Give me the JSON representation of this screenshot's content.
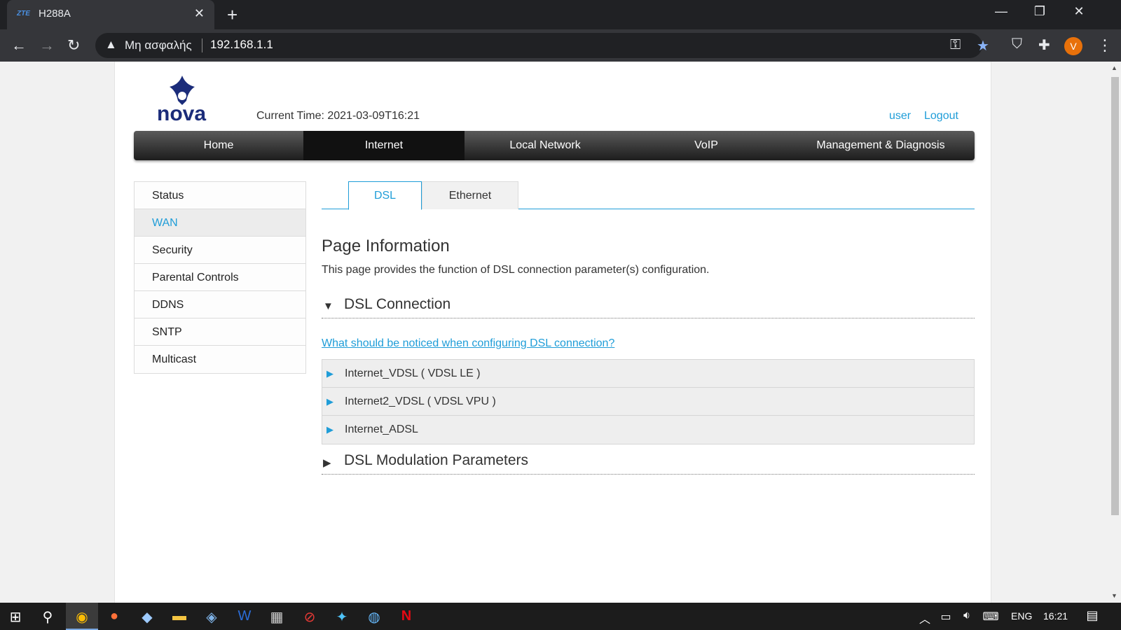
{
  "browser": {
    "tab_title": "H288A",
    "tab_favicon_text": "ZTE",
    "address_security": "Μη ασφαλής",
    "address_url": "192.168.1.1",
    "profile_initial": "V"
  },
  "header": {
    "logo_text": "nova",
    "current_time": "Current Time: 2021-03-09T16:21",
    "user_link": "user",
    "logout_link": "Logout"
  },
  "main_nav": [
    {
      "label": "Home",
      "active": false
    },
    {
      "label": "Internet",
      "active": true
    },
    {
      "label": "Local Network",
      "active": false
    },
    {
      "label": "VoIP",
      "active": false
    },
    {
      "label": "Management & Diagnosis",
      "active": false
    }
  ],
  "side_menu": [
    {
      "label": "Status",
      "active": false
    },
    {
      "label": "WAN",
      "active": true
    },
    {
      "label": "Security",
      "active": false
    },
    {
      "label": "Parental Controls",
      "active": false
    },
    {
      "label": "DDNS",
      "active": false
    },
    {
      "label": "SNTP",
      "active": false
    },
    {
      "label": "Multicast",
      "active": false
    }
  ],
  "sub_tabs": [
    {
      "label": "DSL",
      "active": true
    },
    {
      "label": "Ethernet",
      "active": false
    }
  ],
  "content": {
    "page_heading": "Page Information",
    "page_desc": "This page provides the function of DSL connection parameter(s) configuration.",
    "dsl_section_title": "DSL Connection",
    "help_link": "What should be noticed when configuring DSL connection?",
    "connections": [
      "Internet_VDSL ( VDSL LE )",
      "Internet2_VDSL ( VDSL VPU )",
      "Internet_ADSL"
    ],
    "modulation_section_title": "DSL Modulation Parameters"
  },
  "taskbar": {
    "language": "ENG",
    "clock": "16:21"
  },
  "colors": {
    "accent": "#1f9dd8",
    "nav_dark": "#1d1d1d",
    "logo_blue": "#1b2c7a"
  }
}
